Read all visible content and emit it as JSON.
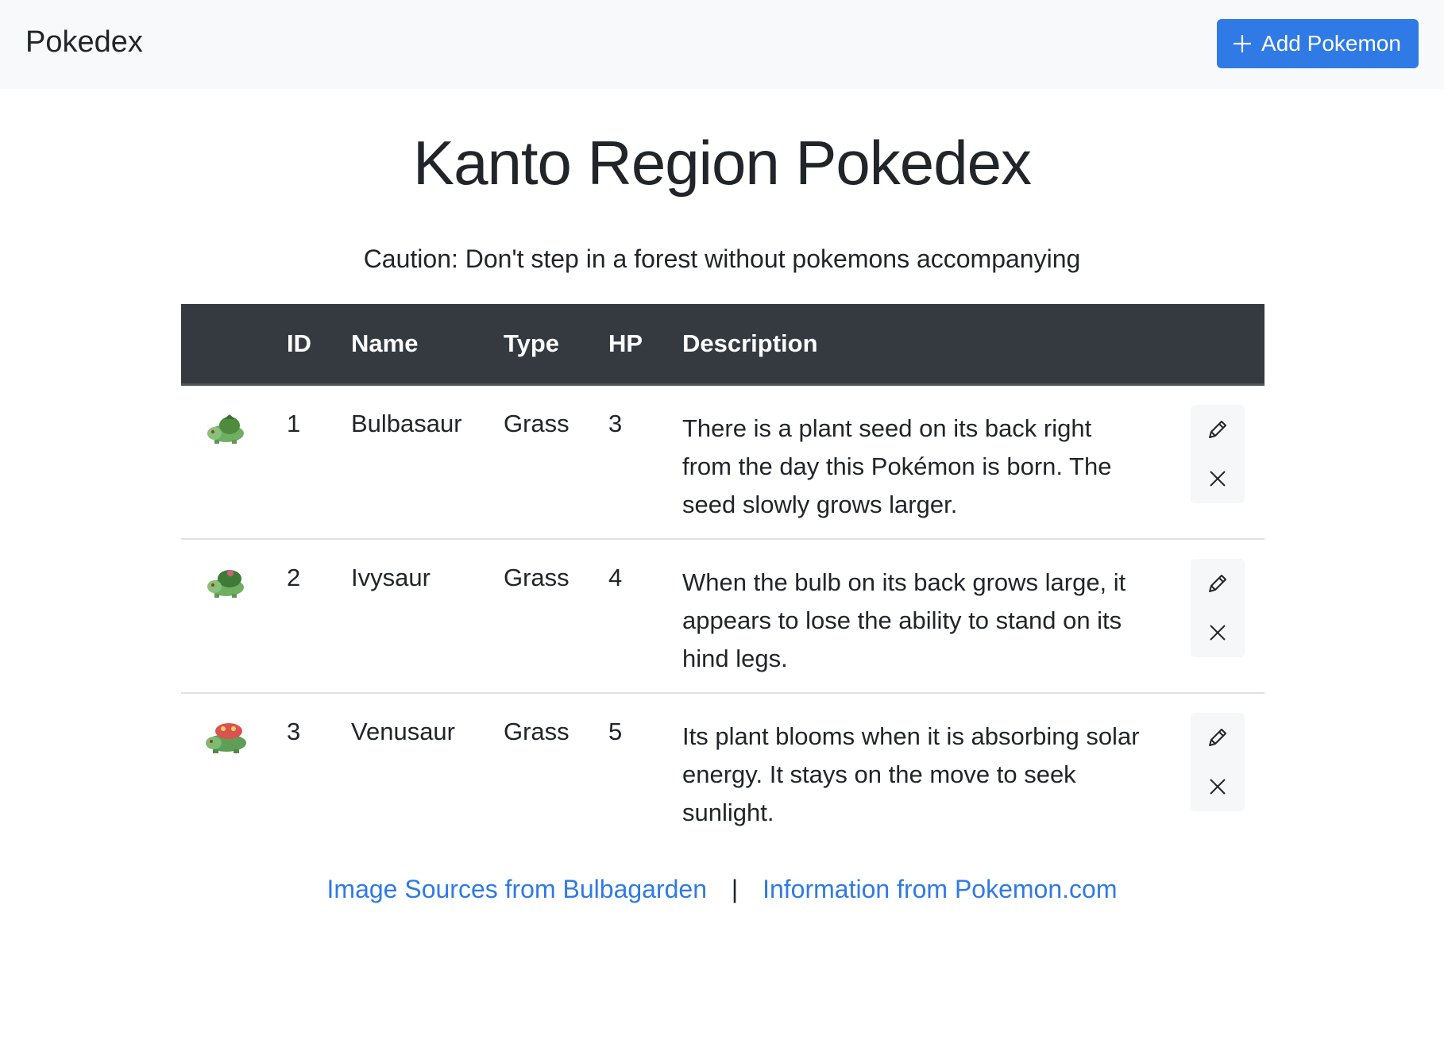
{
  "navbar": {
    "brand": "Pokedex",
    "add_button_label": "Add Pokemon",
    "add_button_icon": "plus-icon",
    "accent_color": "#2f7ae5"
  },
  "main": {
    "title": "Kanto Region Pokedex",
    "caution": "Caution: Don't step in a forest without pokemons accompanying"
  },
  "table": {
    "headers": [
      "",
      "ID",
      "Name",
      "Type",
      "HP",
      "Description",
      ""
    ],
    "rows": [
      {
        "sprite": "bulbasaur-sprite",
        "id": "1",
        "name": "Bulbasaur",
        "type": "Grass",
        "hp": "3",
        "description": "There is a plant seed on its back right from the day this Pokémon is born. The seed slowly grows larger."
      },
      {
        "sprite": "ivysaur-sprite",
        "id": "2",
        "name": "Ivysaur",
        "type": "Grass",
        "hp": "4",
        "description": "When the bulb on its back grows large, it appears to lose the ability to stand on its hind legs."
      },
      {
        "sprite": "venusaur-sprite",
        "id": "3",
        "name": "Venusaur",
        "type": "Grass",
        "hp": "5",
        "description": "Its plant blooms when it is absorbing solar energy. It stays on the move to seek sunlight."
      }
    ],
    "row_actions": [
      "edit-pencil-icon",
      "delete-x-icon"
    ]
  },
  "footer": {
    "link_images": "Image Sources from Bulbagarden",
    "separator": "|",
    "link_info": "Information from Pokemon.com"
  }
}
